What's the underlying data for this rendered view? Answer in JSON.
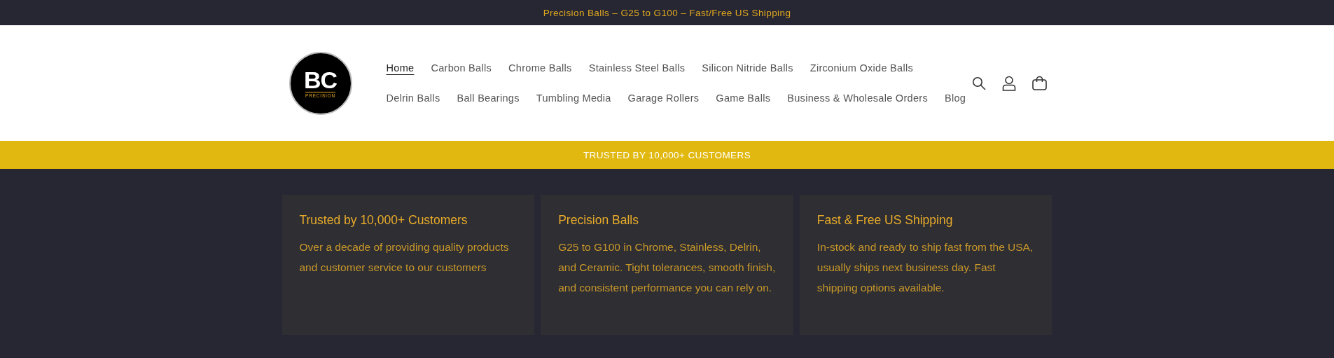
{
  "announcement": "Precision Balls – G25 to G100 – Fast/Free US Shipping",
  "logo": {
    "initials": "BC",
    "subtitle": "PRECISION"
  },
  "nav_rows": [
    [
      {
        "label": "Home",
        "selected": true
      },
      {
        "label": "Carbon Balls",
        "selected": false
      },
      {
        "label": "Chrome Balls",
        "selected": false
      },
      {
        "label": "Stainless Steel Balls",
        "selected": false
      },
      {
        "label": "Silicon Nitride Balls",
        "selected": false
      },
      {
        "label": "Zirconium Oxide Balls",
        "selected": false
      }
    ],
    [
      {
        "label": "Delrin Balls",
        "selected": false
      },
      {
        "label": "Ball Bearings",
        "selected": false
      },
      {
        "label": "Tumbling Media",
        "selected": false
      },
      {
        "label": "Garage Rollers",
        "selected": false
      },
      {
        "label": "Game Balls",
        "selected": false
      },
      {
        "label": "Business & Wholesale Orders",
        "selected": false
      },
      {
        "label": "Blog",
        "selected": false
      }
    ]
  ],
  "banner": "TRUSTED BY 10,000+ CUSTOMERS",
  "features": [
    {
      "title": "Trusted by 10,000+ Customers",
      "text": "Over a decade of providing quality products and customer service to our customers"
    },
    {
      "title": "Precision Balls",
      "text": "G25 to G100 in Chrome, Stainless, Delrin, and Ceramic. Tight tolerances, smooth finish, and consistent performance you can rely on."
    },
    {
      "title": "Fast & Free US Shipping",
      "text": "In-stock and ready to ship fast from the USA, usually ships next business day. Fast shipping options available."
    }
  ]
}
